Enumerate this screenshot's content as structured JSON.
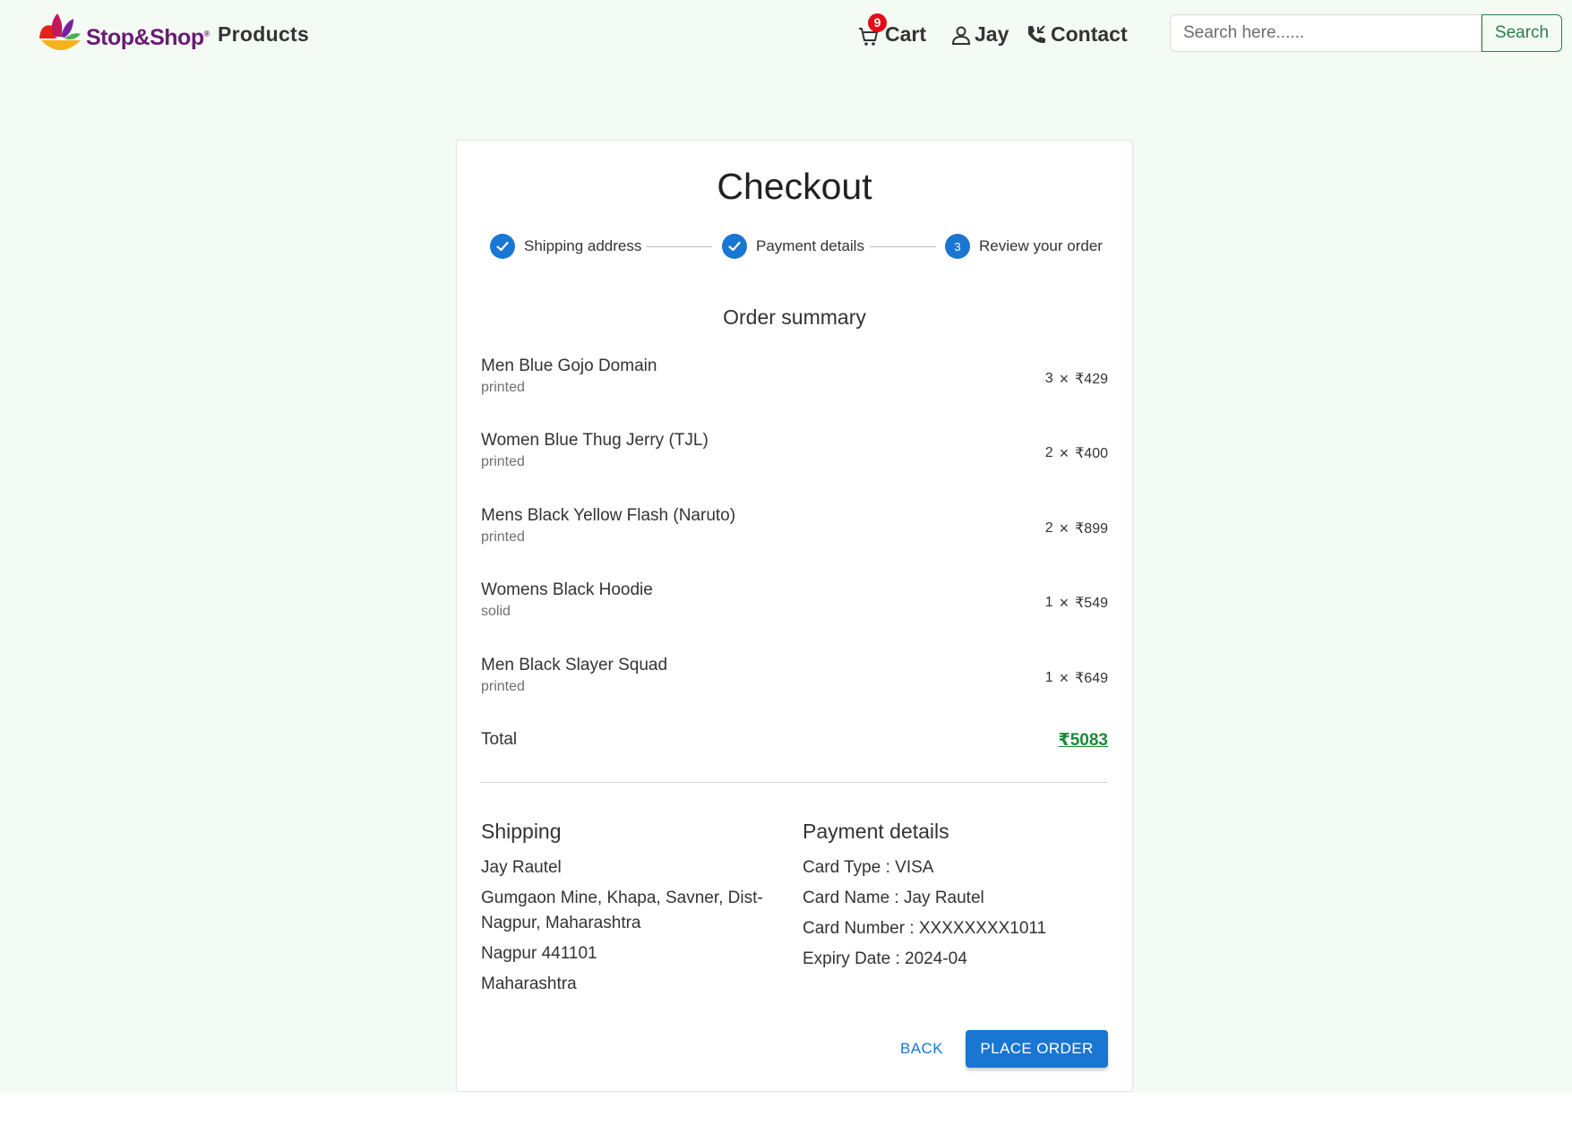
{
  "header": {
    "brand": "Stop&Shop",
    "brand_mark": "®",
    "products_label": "Products",
    "cart_label": "Cart",
    "cart_count": "9",
    "user_label": "Jay",
    "contact_label": "Contact",
    "search_placeholder": "Search here......",
    "search_button": "Search"
  },
  "checkout": {
    "title": "Checkout",
    "steps": [
      {
        "label": "Shipping address",
        "state": "completed",
        "icon": "check-icon"
      },
      {
        "label": "Payment details",
        "state": "completed",
        "icon": "check-icon"
      },
      {
        "label": "Review your order",
        "state": "active",
        "number": "3"
      }
    ],
    "summary_title": "Order summary",
    "items": [
      {
        "name": "Men Blue Gojo Domain",
        "desc": "printed",
        "qty": "3",
        "price": "₹429"
      },
      {
        "name": "Women Blue Thug Jerry (TJL)",
        "desc": "printed",
        "qty": "2",
        "price": "₹400"
      },
      {
        "name": "Mens Black Yellow Flash (Naruto)",
        "desc": "printed",
        "qty": "2",
        "price": "₹899"
      },
      {
        "name": "Womens Black Hoodie",
        "desc": "solid",
        "qty": "1",
        "price": "₹549"
      },
      {
        "name": "Men Black Slayer Squad",
        "desc": "printed",
        "qty": "1",
        "price": "₹649"
      }
    ],
    "times_symbol": "×",
    "total_label": "Total",
    "total_value": "₹5083",
    "shipping": {
      "title": "Shipping",
      "lines": [
        "Jay Rautel",
        "Gumgaon Mine, Khapa, Savner, Dist-Nagpur, Maharashtra",
        "Nagpur 441101",
        "Maharashtra"
      ]
    },
    "payment": {
      "title": "Payment details",
      "lines": [
        "Card Type : VISA",
        "Card Name : Jay Rautel",
        "Card Number : XXXXXXXX1011",
        "Expiry Date : 2024-04"
      ]
    },
    "back_label": "BACK",
    "place_order_label": "PLACE ORDER"
  },
  "colors": {
    "page_background": "#f4fbf5",
    "primary": "#1976d2",
    "total_green": "#1b8a3a",
    "badge_red": "#e30b17",
    "brand_purple": "#6a1b74",
    "search_green": "#2e7d4f"
  }
}
